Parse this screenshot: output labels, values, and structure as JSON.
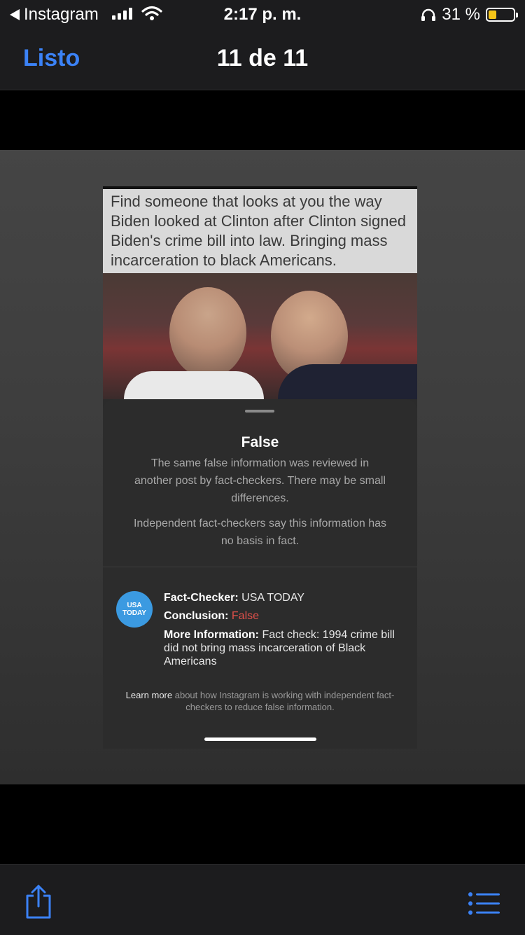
{
  "status_bar": {
    "back_app": "Instagram",
    "time": "2:17 p. m.",
    "battery_text": "31 %",
    "battery_level": 0.31
  },
  "nav": {
    "done_label": "Listo",
    "counter": "11 de 11"
  },
  "post": {
    "meme_text": "Find someone that looks at you the way Biden looked at Clinton after Clinton signed Biden's crime bill into law. Bringing mass incarceration to black Americans."
  },
  "fact_check": {
    "rating": "False",
    "summary": "The same false information was reviewed in another post by fact-checkers. There may be small differences.",
    "statement": "Independent fact-checkers say this information has no basis in fact.",
    "logo_text": "USA TODAY",
    "fact_checker_label": "Fact-Checker:",
    "fact_checker_value": "USA TODAY",
    "conclusion_label": "Conclusion:",
    "conclusion_value": "False",
    "more_info_label": "More Information:",
    "more_info_value": "Fact check: 1994 crime bill did not bring mass incarceration of Black Americans",
    "learn_more_link": "Learn more",
    "learn_more_text": "about how Instagram is working with independent fact-checkers to reduce false information."
  },
  "toolbar": {
    "share_icon": "share-icon",
    "list_icon": "list-icon"
  },
  "colors": {
    "accent": "#3b82f6",
    "false_red": "#e0504a",
    "logo_blue": "#3b9ae1"
  }
}
